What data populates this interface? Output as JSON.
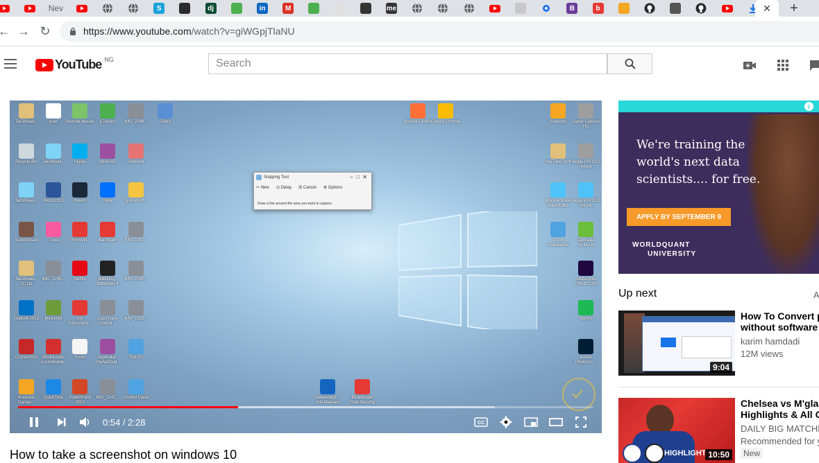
{
  "browser": {
    "tabs": [
      {
        "icon": "youtube-icon",
        "color": "#ff0000"
      },
      {
        "icon": "youtube-icon",
        "color": "#ff0000"
      },
      {
        "icon": "new-tab-text",
        "text": "Nev"
      },
      {
        "icon": "youtube-icon",
        "color": "#ff0000"
      },
      {
        "icon": "globe-icon",
        "color": "#5f6368"
      },
      {
        "icon": "globe-icon",
        "color": "#5f6368"
      },
      {
        "icon": "s-icon",
        "text": "S",
        "color": "#1aa3d9"
      },
      {
        "icon": "dj-icon",
        "color": "#2b2b2b"
      },
      {
        "icon": "dj-icon",
        "text": "dj",
        "color": "#0c4b33"
      },
      {
        "icon": "w3-icon",
        "color": "#4caf50"
      },
      {
        "icon": "linkedin-icon",
        "text": "in",
        "color": "#0a66c2"
      },
      {
        "icon": "gmail-icon",
        "text": "M",
        "color": "#d93025"
      },
      {
        "icon": "w3-icon",
        "color": "#4caf50"
      },
      {
        "icon": "doc-icon",
        "color": "#e0e0e0"
      },
      {
        "icon": "window-icon",
        "color": "#333333"
      },
      {
        "icon": "medium-icon",
        "text": "me",
        "color": "#333333"
      },
      {
        "icon": "globe-icon",
        "color": "#5f6368"
      },
      {
        "icon": "globe-icon",
        "color": "#5f6368"
      },
      {
        "icon": "globe-icon",
        "color": "#5f6368"
      },
      {
        "icon": "youtube-icon",
        "color": "#ff0000"
      },
      {
        "icon": "page-icon",
        "color": "#c8c8c8"
      },
      {
        "icon": "gear-icon",
        "color": "#1a73e8"
      },
      {
        "icon": "b-icon",
        "text": "B",
        "color": "#6a3d9a"
      },
      {
        "icon": "b-icon",
        "text": "b",
        "color": "#e53935"
      },
      {
        "icon": "shield-icon",
        "color": "#f5a623"
      },
      {
        "icon": "github-icon",
        "color": "#24292e"
      },
      {
        "icon": "book-icon",
        "color": "#555555"
      },
      {
        "icon": "github-icon",
        "color": "#24292e"
      },
      {
        "icon": "youtube-icon",
        "color": "#ff0000"
      },
      {
        "icon": "download-icon",
        "color": "#1a73e8"
      }
    ],
    "url_domain": "https://www.youtube.com",
    "url_path": "/watch?v=giWGpjTlaNU"
  },
  "youtube": {
    "logo_text": "YouTube",
    "country_code": "NG",
    "search_placeholder": "Search"
  },
  "video": {
    "title": "How to take a screenshot on windows 10",
    "time_display": "0:54 / 2:28",
    "progress_played": 0.383,
    "progress_buffered": 0.83,
    "snipping_tool": {
      "title": "Snipping Tool",
      "new": "New",
      "delay": "Delay",
      "cancel": "Cancel",
      "options": "Options",
      "message": "Draw a line around the area you want to capture."
    },
    "desktop_icons": [
      {
        "label": "TaiGBreak...",
        "color": "#e0c07a"
      },
      {
        "label": "duet",
        "color": "#ffffff"
      },
      {
        "label": "Remote Mouse",
        "color": "#7cc46a"
      },
      {
        "label": "µTorrent",
        "color": "#4caf50"
      },
      {
        "label": "IMG_2248...",
        "color": "#8a8f97"
      },
      {
        "label": "Debry",
        "color": "#5a8fd6"
      },
      {
        "label": "Recycle Bin",
        "color": "#cfd8dc"
      },
      {
        "label": "TaiGBreak...",
        "color": "#7fd3f7"
      },
      {
        "label": "Skype",
        "color": "#00aff0"
      },
      {
        "label": "WinRAR",
        "color": "#9c4fa0"
      },
      {
        "label": "Reflector",
        "color": "#e57373"
      },
      {
        "label": "TaiGBreak...",
        "color": "#7fd3f7"
      },
      {
        "label": "Word 2013",
        "color": "#2b579a"
      },
      {
        "label": "Steam",
        "color": "#1b2838"
      },
      {
        "label": "Uplay",
        "color": "#0070ff"
      },
      {
        "label": "SpaceSniff...",
        "color": "#f5c542"
      },
      {
        "label": "AudioWizard",
        "color": "#795548"
      },
      {
        "label": "iTunes",
        "color": "#fa5aa0"
      },
      {
        "label": "UmmyVid...",
        "color": "#e53935"
      },
      {
        "label": "Bandicam",
        "color": "#e53935"
      },
      {
        "label": "IMG_2251...",
        "color": "#8a8f97"
      },
      {
        "label": "TaiGBreak... (1).zip",
        "color": "#e0c07a"
      },
      {
        "label": "IMG_2249...",
        "color": "#8a8f97"
      },
      {
        "label": "Netflix",
        "color": "#e50914"
      },
      {
        "label": "Battlelog - Battlefield 4",
        "color": "#222222"
      },
      {
        "label": "IMG_2250...",
        "color": "#8a8f97"
      },
      {
        "label": "Outlook 2013",
        "color": "#0072c6"
      },
      {
        "label": "Minecraft",
        "color": "#6d9b3a"
      },
      {
        "label": "My Subscriptio...",
        "color": "#e53935"
      },
      {
        "label": "CopyTrans Control ...",
        "color": "#8a8f97"
      },
      {
        "label": "IMG_2252...",
        "color": "#8a8f97"
      },
      {
        "label": "CronusPRO",
        "color": "#c62828"
      },
      {
        "label": "PhotoLooks LooksBuilder",
        "color": "#d32f2f"
      },
      {
        "label": "Fonts",
        "color": "#f5f5f5"
      },
      {
        "label": "keymaker TheApkDud...",
        "color": "#9c4fa0"
      },
      {
        "label": "This PC",
        "color": "#4fa3e0"
      },
      {
        "label": "Rockstar Games...",
        "color": "#f5a623"
      },
      {
        "label": "QuickTime",
        "color": "#1e88e5"
      },
      {
        "label": "PowerPoint 2013",
        "color": "#d24726"
      },
      {
        "label": "IMG_2247...",
        "color": "#8a8f97"
      },
      {
        "label": "Control Panel",
        "color": "#4fa3e0"
      },
      {
        "label": "Mozilla Firefox",
        "color": "#ff7139"
      },
      {
        "label": "Google Chrome",
        "color": "#fbbc05"
      },
      {
        "label": "Audacity",
        "color": "#f5a623"
      },
      {
        "label": "Game Capture HD",
        "color": "#9e9e9e"
      },
      {
        "label": "YouTube Stuff",
        "color": "#e0c07a"
      },
      {
        "label": "Vegas Pro 13.0 (64-bit)",
        "color": "#9e9e9e"
      },
      {
        "label": "Wondershare Video Editor",
        "color": "#4fc3f7"
      },
      {
        "label": "Vegas Pro 12.0 (64-bit)",
        "color": "#4fc3f7"
      },
      {
        "label": "XSplit Broadcaster",
        "color": "#4fa3e0"
      },
      {
        "label": "Camtasia Studio 8",
        "color": "#6bbf3b"
      },
      {
        "label": "Adobe After Effects CS6",
        "color": "#1f0740"
      },
      {
        "label": "Spotify",
        "color": "#1db954"
      },
      {
        "label": "Adobe Photosho...",
        "color": "#001e36"
      },
      {
        "label": "Malwarebyt... Anti-Malware",
        "color": "#1565c0"
      },
      {
        "label": "Bitdefender Total Security",
        "color": "#e53935"
      }
    ]
  },
  "ad": {
    "headline": "We're training the world's next data scientists.... for free.",
    "cta": "APPLY BY SEPTEMBER 9",
    "university_line1": "WORLDQUANT",
    "university_line2": "UNIVERSITY"
  },
  "sidebar": {
    "up_next": "Up next",
    "autoplay_letter": "A",
    "items": [
      {
        "title_line1": "How To Convert p",
        "title_line2": "without software",
        "channel": "karim hamdadi",
        "views": "12M views",
        "duration": "9:04"
      },
      {
        "title_line1": "Chelsea vs M'glad",
        "title_line2": "Highlights & All Go",
        "channel": "DAILY BIG MATCHE",
        "views": "Recommended for y",
        "badge": "New",
        "duration": "10:50",
        "thumb_overlay_text": "HIGHLIGHT"
      }
    ]
  }
}
